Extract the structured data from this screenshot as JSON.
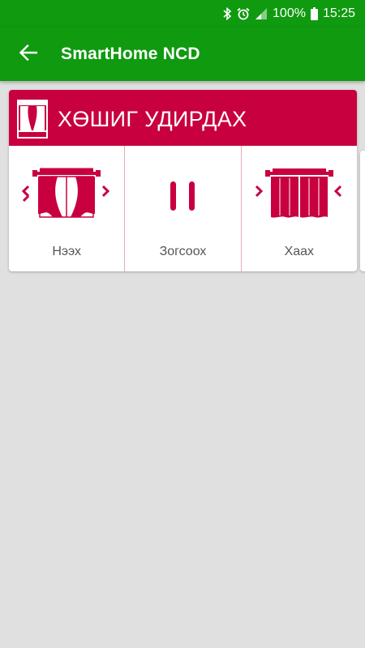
{
  "status_bar": {
    "icons": [
      "bluetooth-icon",
      "alarm-icon",
      "signal-icon",
      "battery-icon"
    ],
    "battery": "100%",
    "time": "15:25"
  },
  "app_bar": {
    "back_icon": "arrow-left-icon",
    "title": "SmartHome NCD"
  },
  "card": {
    "icon": "curtain-icon",
    "title": "ХӨШИГ УДИРДАХ",
    "controls": [
      {
        "label": "Нээх",
        "icon": "curtain-open-icon"
      },
      {
        "label": "Зогсоох",
        "icon": "pause-icon"
      },
      {
        "label": "Хаах",
        "icon": "curtain-close-icon"
      }
    ]
  },
  "colors": {
    "primary": "#0f9a0f",
    "accent": "#c8003f",
    "background": "#e0e0e0"
  }
}
